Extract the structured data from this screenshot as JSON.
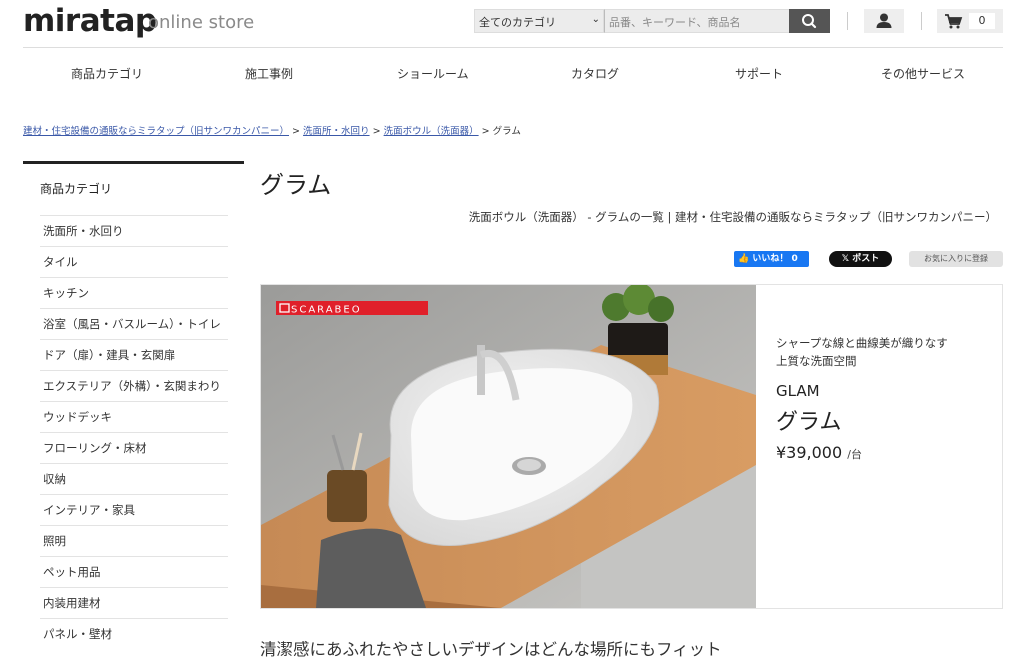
{
  "header": {
    "logo": "miratap",
    "logo_sub": "online store",
    "category_select": "全てのカテゴリ",
    "search_placeholder": "品番、キーワード、商品名",
    "cart_count": "0"
  },
  "nav": [
    "商品カテゴリ",
    "施工事例",
    "ショールーム",
    "カタログ",
    "サポート",
    "その他サービス"
  ],
  "breadcrumb": {
    "links": [
      "建材・住宅設備の通販ならミラタップ（旧サンワカンパニー）",
      "洗面所・水回り",
      "洗面ボウル（洗面器）"
    ],
    "current": "グラム",
    "separator": ">"
  },
  "sidebar": {
    "title": "商品カテゴリ",
    "items": [
      "洗面所・水回り",
      "タイル",
      "キッチン",
      "浴室（風呂・バスルーム）・トイレ",
      "ドア（扉）・建具・玄関扉",
      "エクステリア（外構）・玄関まわり",
      "ウッドデッキ",
      "フローリング・床材",
      "収納",
      "インテリア・家具",
      "照明",
      "ペット用品",
      "内装用建材",
      "パネル・壁材"
    ]
  },
  "main": {
    "title": "グラム",
    "subtitle": "洗面ボウル（洗面器） - グラムの一覧 | 建材・住宅設備の通販ならミラタップ（旧サンワカンパニー）",
    "like_label": "いいね！ 0",
    "post_label": "ポスト",
    "fav_label": "お気に入りに登録",
    "brand": "SCARABEO",
    "hero_line1": "シャープな線と曲線美が織りなす",
    "hero_line2": "上質な洗面空間",
    "hero_en": "GLAM",
    "hero_name": "グラム",
    "hero_price": "¥39,000",
    "hero_unit": "/台",
    "tagline": "清潔感にあふれたやさしいデザインはどんな場所にもフィット"
  },
  "colors": {
    "link": "#3a58a8",
    "facebook": "#1877f2",
    "brand_red": "#e0202a"
  }
}
